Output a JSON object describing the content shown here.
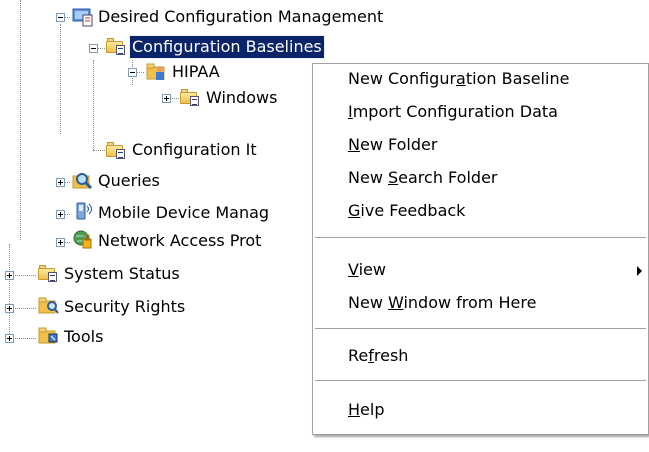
{
  "tree": {
    "dcm": "Desired Configuration Management",
    "baselines": "Configuration Baselines",
    "hipaa": "HIPAA",
    "windows": "Windows",
    "items": "Configuration It",
    "queries": "Queries",
    "mobile": "Mobile Device Manag",
    "nap": "Network Access Prot",
    "status": "System Status",
    "security": "Security Rights",
    "tools": "Tools"
  },
  "menu": {
    "new_baseline": {
      "pre": "New Configur",
      "acc": "a",
      "post": "tion Baseline"
    },
    "import": {
      "pre": "",
      "acc": "I",
      "post": "mport Configuration Data"
    },
    "new_folder": {
      "pre": "",
      "acc": "N",
      "post": "ew Folder"
    },
    "new_search": {
      "pre": "New ",
      "acc": "S",
      "post": "earch Folder"
    },
    "feedback": {
      "pre": "",
      "acc": "G",
      "post": "ive Feedback"
    },
    "view": {
      "pre": "",
      "acc": "V",
      "post": "iew"
    },
    "new_window": {
      "pre": "New ",
      "acc": "W",
      "post": "indow from Here"
    },
    "refresh": {
      "pre": "Re",
      "acc": "f",
      "post": "resh"
    },
    "help": {
      "pre": "",
      "acc": "H",
      "post": "elp"
    }
  },
  "colors": {
    "selection": "#0a246a",
    "menu_border": "#a0a0a0",
    "tree_lines": "#8a8a8a"
  }
}
